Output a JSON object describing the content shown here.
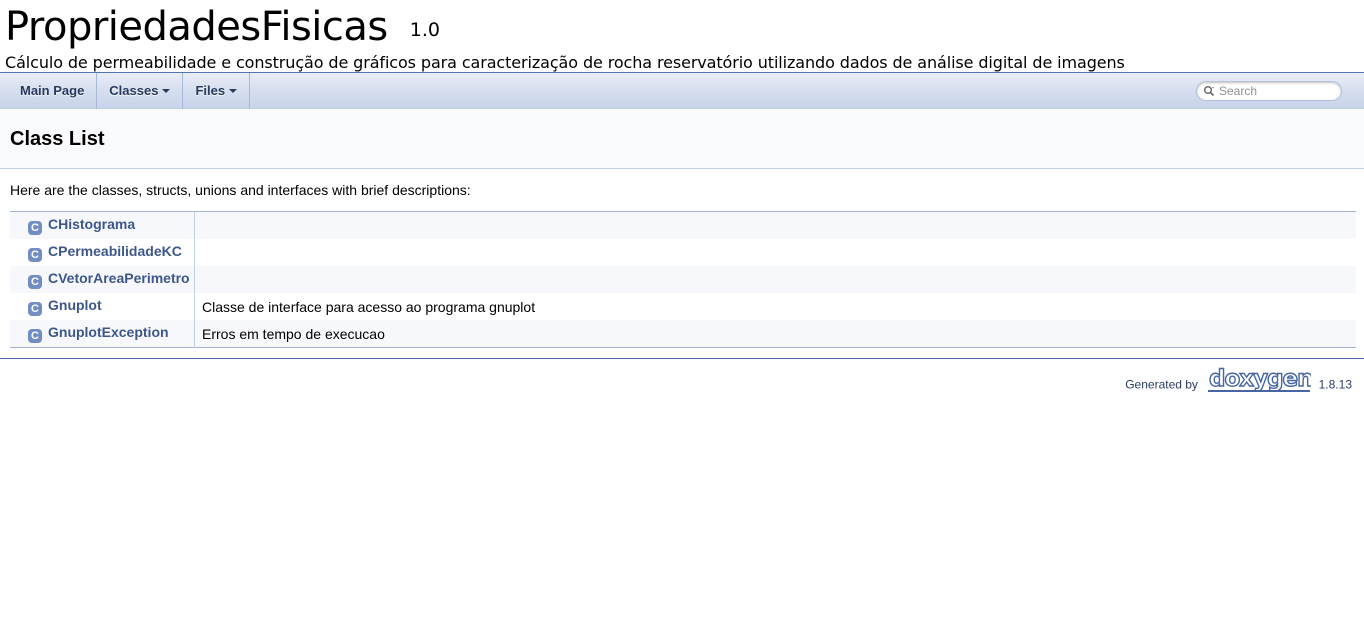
{
  "project": {
    "name": "PropriedadesFisicas",
    "number": "1.0",
    "brief": "Cálculo de permeabilidade e construção de gráficos para caracterização de rocha reservatório utilizando dados de análise digital de imagens"
  },
  "nav": {
    "tabs": [
      {
        "label": "Main Page",
        "dropdown": false
      },
      {
        "label": "Classes",
        "dropdown": true
      },
      {
        "label": "Files",
        "dropdown": true
      }
    ],
    "search_placeholder": "Search"
  },
  "page": {
    "title": "Class List",
    "intro": "Here are the classes, structs, unions and interfaces with brief descriptions:"
  },
  "classes": [
    {
      "icon": "C",
      "name": "CHistograma",
      "desc": ""
    },
    {
      "icon": "C",
      "name": "CPermeabilidadeKC",
      "desc": ""
    },
    {
      "icon": "C",
      "name": "CVetorAreaPerimetro",
      "desc": ""
    },
    {
      "icon": "C",
      "name": "Gnuplot",
      "desc": "Classe de interface para acesso ao programa gnuplot"
    },
    {
      "icon": "C",
      "name": "GnuplotException",
      "desc": "Erros em tempo de execucao"
    }
  ],
  "footer": {
    "generated_by": "Generated by",
    "logo_text": "doxygen",
    "version": "1.8.13"
  },
  "colors": {
    "link": "#3D578C",
    "icon_bg": "#728DC1",
    "nav_text": "#283A5D",
    "border": "#C4CFE5"
  }
}
